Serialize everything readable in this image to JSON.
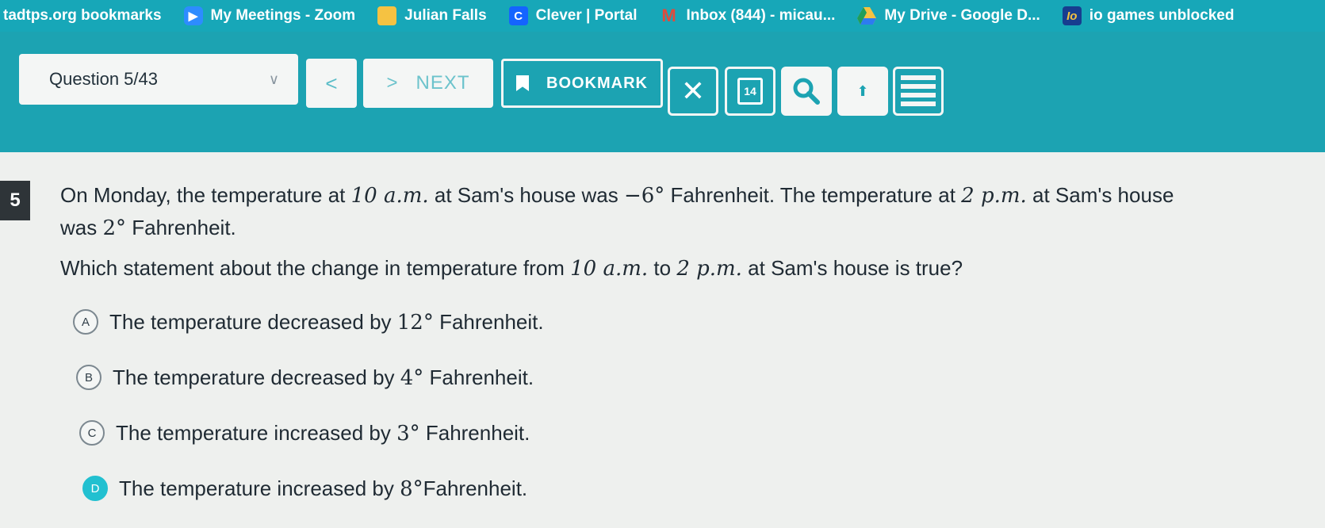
{
  "bookmarks": [
    {
      "label": "tadtps.org bookmarks",
      "icon": "none"
    },
    {
      "label": "My Meetings - Zoom",
      "icon": "zoom-icon"
    },
    {
      "label": "Julian Falls",
      "icon": "folder-icon"
    },
    {
      "label": "Clever | Portal",
      "icon": "clever-icon"
    },
    {
      "label": "Inbox (844) - micau...",
      "icon": "gmail-icon"
    },
    {
      "label": "My Drive - Google D...",
      "icon": "drive-icon"
    },
    {
      "label": "io games unblocked",
      "icon": "io-icon"
    }
  ],
  "toolbar": {
    "question_selector": "Question 5/43",
    "prev_glyph": "<",
    "next_glyph": ">",
    "next_label": "NEXT",
    "bookmark_label": "BOOKMARK",
    "close_glyph": "✕",
    "calendar_day": "14",
    "upload_glyph": "⬆"
  },
  "question": {
    "number": "5",
    "line1_a": "On Monday, the temperature at ",
    "time1": "10 a.m.",
    "line1_b": " at Sam's house was ",
    "temp1": "−6°",
    "line1_c": " Fahrenheit. The temperature at ",
    "time2": "2 p.m.",
    "line1_d": " at Sam's house",
    "line2_a": "was ",
    "temp2": "2°",
    "line2_b": " Fahrenheit.",
    "prompt_a": "Which statement about the change in temperature from ",
    "prompt_time1": "10 a.m.",
    "prompt_b": " to ",
    "prompt_time2": "2 p.m.",
    "prompt_c": " at Sam's house is true?"
  },
  "choices": [
    {
      "letter": "A",
      "text_a": "The temperature decreased by ",
      "value": "12°",
      "text_b": " Fahrenheit.",
      "selected": false
    },
    {
      "letter": "B",
      "text_a": "The temperature decreased by ",
      "value": "4°",
      "text_b": " Fahrenheit.",
      "selected": false
    },
    {
      "letter": "C",
      "text_a": "The temperature increased by ",
      "value": "3°",
      "text_b": " Fahrenheit.",
      "selected": false
    },
    {
      "letter": "D",
      "text_a": "The temperature increased by ",
      "value": "8°",
      "text_b": "Fahrenheit.",
      "selected": true
    }
  ],
  "colors": {
    "bookmarks_bar": "#17a7b8",
    "toolbar": "#1ca3b2",
    "selected_choice": "#22c0d0"
  }
}
